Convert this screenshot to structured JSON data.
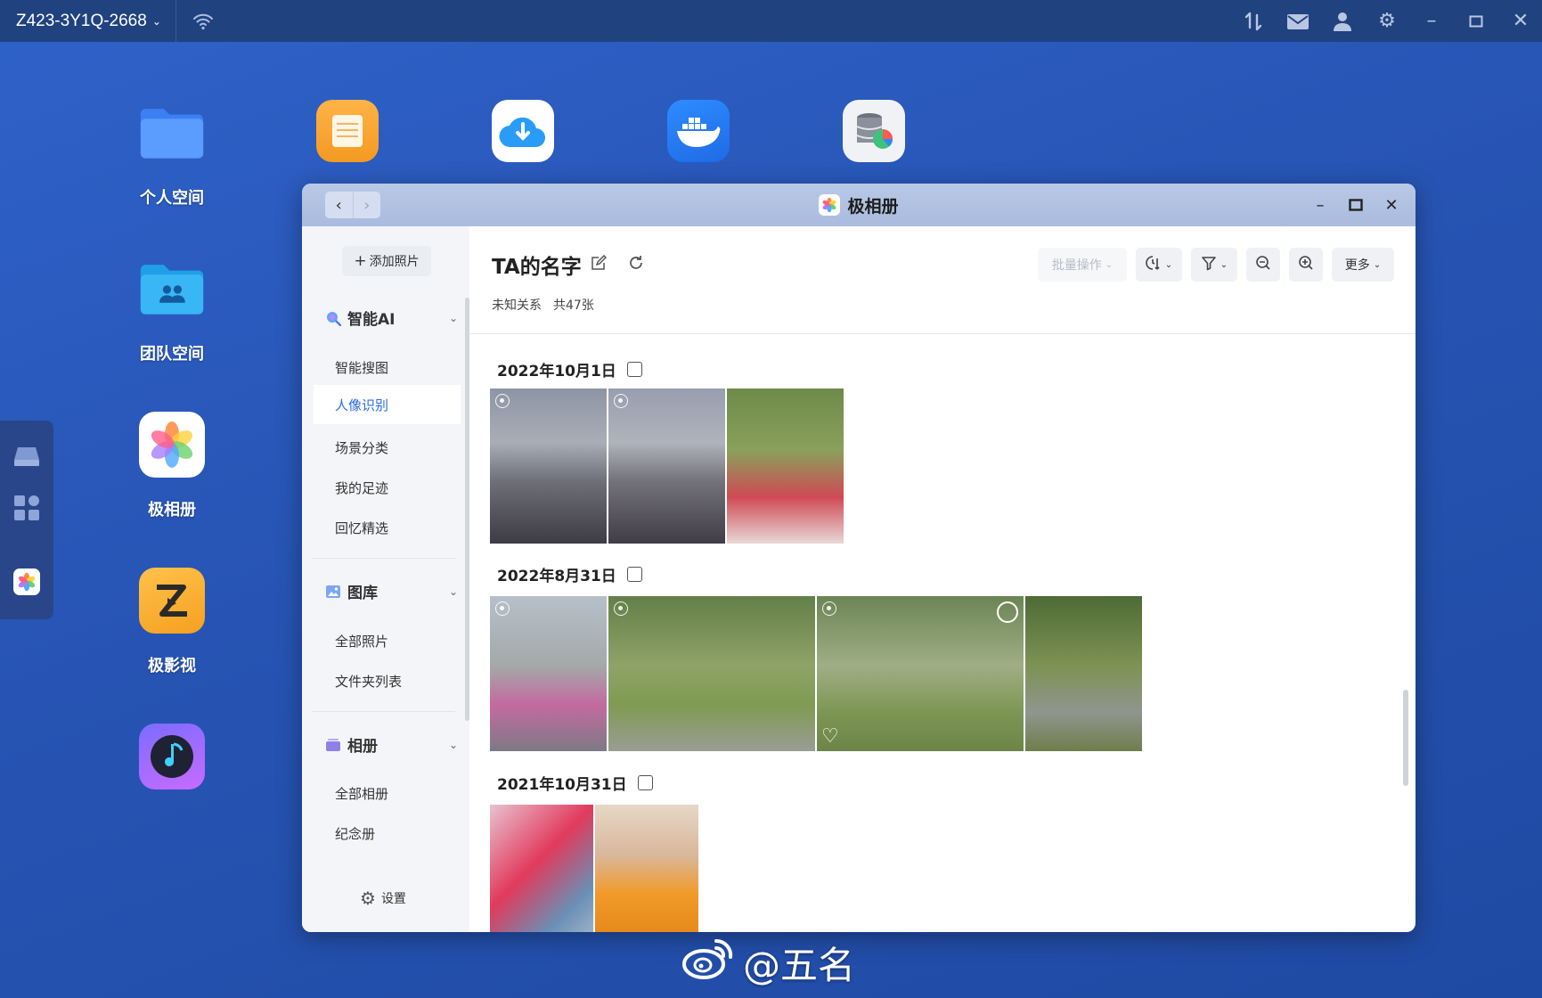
{
  "topbar": {
    "device_name": "Z423-3Y1Q-2668",
    "icons": [
      "transfer-icon",
      "mail-icon",
      "user-icon",
      "gear-icon",
      "minimize-icon",
      "maximize-icon",
      "close-icon"
    ]
  },
  "desktop": {
    "icons": [
      {
        "label": "个人空间",
        "icon": "folder-icon"
      },
      {
        "label": "团队空间",
        "icon": "team-folder-icon"
      },
      {
        "label": "极相册",
        "icon": "photos-app-icon"
      },
      {
        "label": "极影视",
        "icon": "video-app-icon"
      },
      {
        "label": "",
        "icon": "music-app-icon"
      }
    ],
    "top_row": [
      "notes-app-icon",
      "download-app-icon",
      "docker-app-icon",
      "database-app-icon"
    ]
  },
  "window": {
    "title": "极相册",
    "sidebar": {
      "add_photo": "添加照片",
      "sections": [
        {
          "title": "智能AI",
          "items": [
            "智能搜图",
            "人像识别",
            "场景分类",
            "我的足迹",
            "回忆精选"
          ]
        },
        {
          "title": "图库",
          "items": [
            "全部照片",
            "文件夹列表"
          ]
        },
        {
          "title": "相册",
          "items": [
            "全部相册",
            "纪念册"
          ]
        }
      ],
      "active_item": "人像识别",
      "settings": "设置"
    },
    "main": {
      "title": "TA的名字",
      "relation": "未知关系",
      "count": "共47张",
      "toolbar": {
        "batch": "批量操作",
        "more": "更多"
      },
      "groups": [
        {
          "date": "2022年10月1日",
          "photo_count": 3
        },
        {
          "date": "2022年8月31日",
          "photo_count": 4
        },
        {
          "date": "2021年10月31日",
          "photo_count": 2
        }
      ]
    }
  },
  "watermark": "@五名",
  "colors": {
    "accent": "#2b6ce6",
    "desktop": "#2754b4",
    "topbar": "#20427f"
  }
}
